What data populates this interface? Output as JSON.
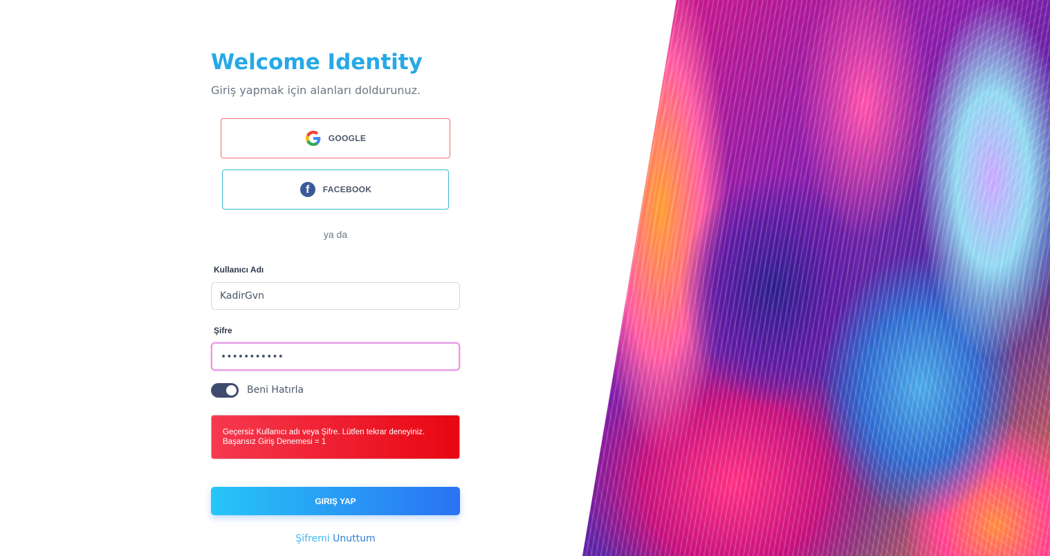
{
  "header": {
    "title": "Welcome Identity",
    "subtitle": "Giriş yapmak için alanları doldurunuz."
  },
  "social": {
    "google_label": "GOOGLE",
    "facebook_label": "FACEBOOK",
    "facebook_glyph": "f"
  },
  "divider_text": "ya da",
  "form": {
    "username_label": "Kullanıcı Adı",
    "username_value": "KadirGvn",
    "password_label": "Şifre",
    "password_value": "passwordpas",
    "remember_label": "Beni Hatırla",
    "remember_checked": true
  },
  "alert": {
    "line1": "Geçersiz Kullanıcı adı veya Şifre. Lütfen tekrar deneyiniz.",
    "line2": "Başarısız Giriş Denemesi = 1"
  },
  "submit_label": "GIRIŞ YAP",
  "forgot": {
    "word1": "Şifremi",
    "word2": "Unuttum"
  },
  "colors": {
    "title": "#26a9e6",
    "google_border": "#f0696c",
    "facebook_border": "#33bcd0",
    "alert_start": "#f5394f",
    "alert_end": "#e80612",
    "button_start": "#27c6f8",
    "button_end": "#2a72f2"
  },
  "icons": {
    "google": "google-icon",
    "facebook": "facebook-icon"
  }
}
